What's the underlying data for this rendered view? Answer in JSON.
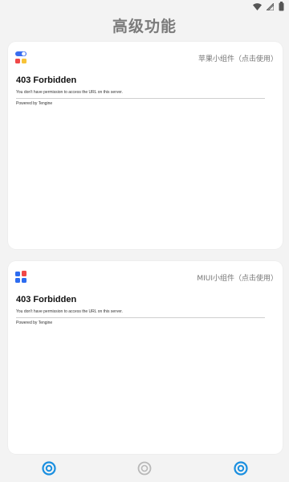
{
  "status_bar": {
    "icons": [
      "wifi-icon",
      "signal-icon",
      "battery-icon"
    ]
  },
  "page": {
    "title": "高级功能"
  },
  "cards": [
    {
      "link_label": "苹果小组件（点击使用）",
      "embed": {
        "title": "403 Forbidden",
        "description": "You don't have permission to access the URL on this server.",
        "footer": "Powered by Tengine"
      }
    },
    {
      "link_label": "MIUI小组件（点击使用）",
      "embed": {
        "title": "403 Forbidden",
        "description": "You don't have permission to access the URL on this server.",
        "footer": "Powered by Tengine"
      }
    }
  ],
  "bottom_nav": {
    "items": [
      {
        "icon": "home-icon",
        "active": true
      },
      {
        "icon": "circle-icon",
        "active": false
      },
      {
        "icon": "profile-icon",
        "active": true
      }
    ]
  },
  "colors": {
    "background": "#f3f3f3",
    "card": "#ffffff",
    "accent": "#1a8fe0",
    "title": "#7b7b7b"
  }
}
